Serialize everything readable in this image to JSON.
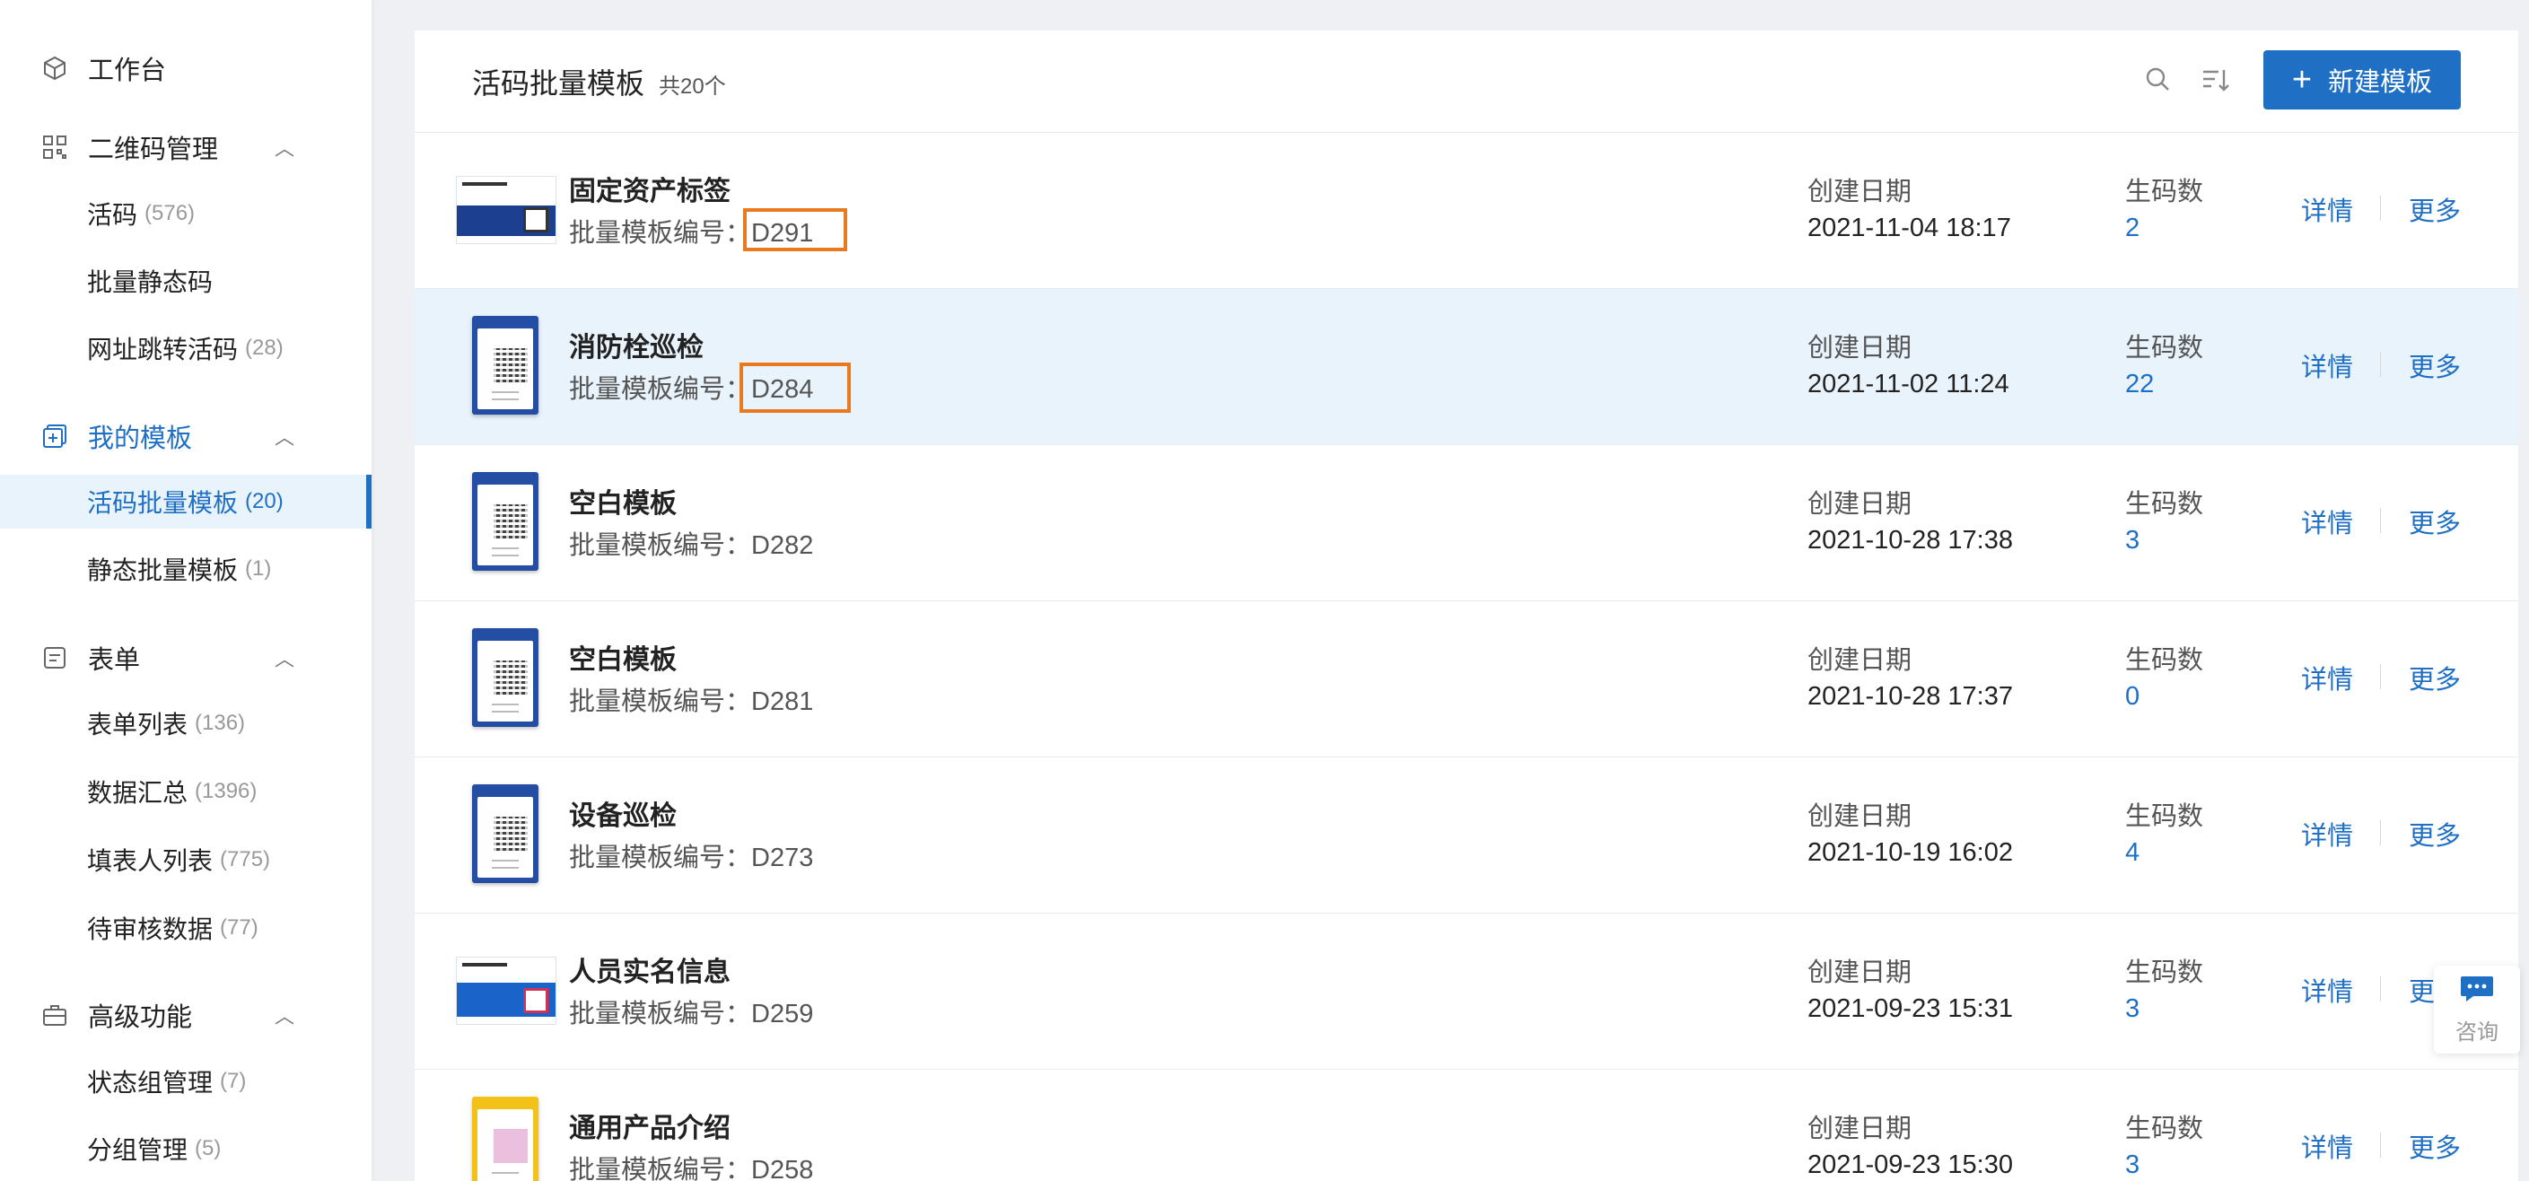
{
  "sidebar": {
    "workbench": "工作台",
    "qr_group": {
      "label": "二维码管理",
      "items": [
        {
          "label": "活码",
          "count": "(576)"
        },
        {
          "label": "批量静态码",
          "count": ""
        },
        {
          "label": "网址跳转活码",
          "count": "(28)"
        }
      ]
    },
    "template_group": {
      "label": "我的模板",
      "items": [
        {
          "label": "活码批量模板",
          "count": "(20)"
        },
        {
          "label": "静态批量模板",
          "count": "(1)"
        }
      ]
    },
    "form_group": {
      "label": "表单",
      "items": [
        {
          "label": "表单列表",
          "count": "(136)"
        },
        {
          "label": "数据汇总",
          "count": "(1396)"
        },
        {
          "label": "填表人列表",
          "count": "(775)"
        },
        {
          "label": "待审核数据",
          "count": "(77)"
        }
      ]
    },
    "advanced_group": {
      "label": "高级功能",
      "items": [
        {
          "label": "状态组管理",
          "count": "(7)"
        },
        {
          "label": "分组管理",
          "count": "(5)"
        }
      ]
    }
  },
  "header": {
    "title": "活码批量模板",
    "total": "共20个",
    "new_button": "新建模板"
  },
  "rows": [
    {
      "name": "固定资产标签",
      "code_label": "批量模板编号：",
      "code": "D291",
      "date_label": "创建日期",
      "date": "2021-11-04 18:17",
      "count_label": "生码数",
      "count": "2",
      "detail": "详情",
      "more": "更多"
    },
    {
      "name": "消防栓巡检",
      "code_label": "批量模板编号：",
      "code": "D284",
      "date_label": "创建日期",
      "date": "2021-11-02 11:24",
      "count_label": "生码数",
      "count": "22",
      "detail": "详情",
      "more": "更多"
    },
    {
      "name": "空白模板",
      "code_label": "批量模板编号：",
      "code": "D282",
      "date_label": "创建日期",
      "date": "2021-10-28 17:38",
      "count_label": "生码数",
      "count": "3",
      "detail": "详情",
      "more": "更多"
    },
    {
      "name": "空白模板",
      "code_label": "批量模板编号：",
      "code": "D281",
      "date_label": "创建日期",
      "date": "2021-10-28 17:37",
      "count_label": "生码数",
      "count": "0",
      "detail": "详情",
      "more": "更多"
    },
    {
      "name": "设备巡检",
      "code_label": "批量模板编号：",
      "code": "D273",
      "date_label": "创建日期",
      "date": "2021-10-19 16:02",
      "count_label": "生码数",
      "count": "4",
      "detail": "详情",
      "more": "更多"
    },
    {
      "name": "人员实名信息",
      "code_label": "批量模板编号：",
      "code": "D259",
      "date_label": "创建日期",
      "date": "2021-09-23 15:31",
      "count_label": "生码数",
      "count": "3",
      "detail": "详情",
      "more": "更多"
    },
    {
      "name": "通用产品介绍",
      "code_label": "批量模板编号：",
      "code": "D258",
      "date_label": "创建日期",
      "date": "2021-09-23 15:30",
      "count_label": "生码数",
      "count": "3",
      "detail": "详情",
      "more": "更多"
    }
  ],
  "consult": {
    "label": "咨询"
  },
  "colors": {
    "accent": "#1f6fc5",
    "highlight_box": "#e8791e",
    "selected_row": "#e9f3fc"
  }
}
